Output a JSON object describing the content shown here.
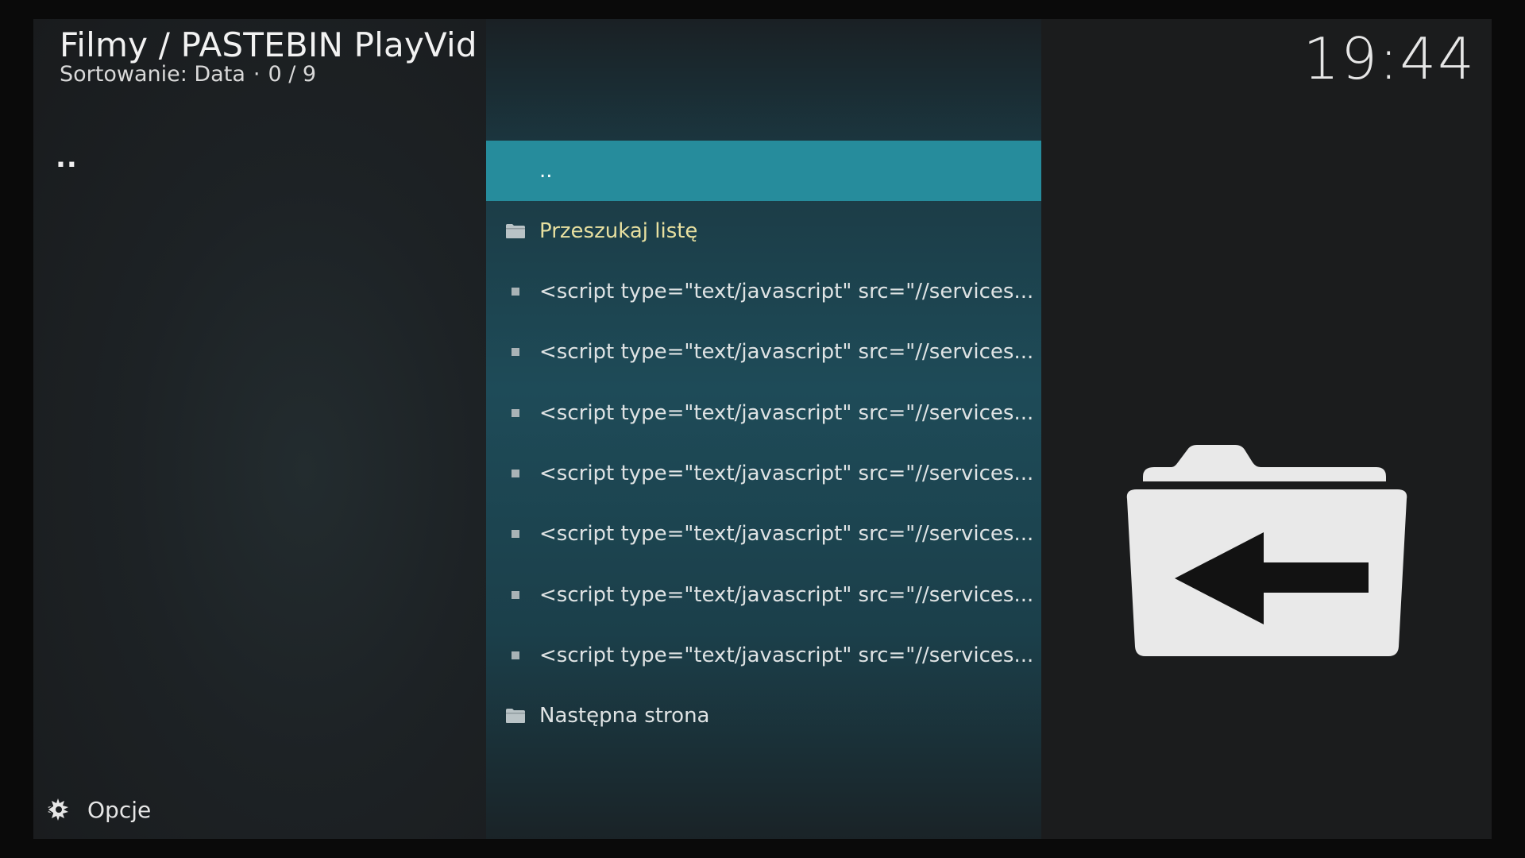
{
  "header": {
    "path": "Filmy / PASTEBIN PlayVid",
    "sort_label": "Sortowanie: Data",
    "separator": "·",
    "position": "0 / 9"
  },
  "clock": "19:44",
  "left": {
    "parent_marker": ".."
  },
  "list": {
    "items": [
      {
        "label": "..",
        "kind": "parent",
        "selected": true
      },
      {
        "label": "Przeszukaj listę",
        "kind": "folder"
      },
      {
        "label": "<script type=\"text/javascript\" src=\"//services...",
        "kind": "file"
      },
      {
        "label": "<script type=\"text/javascript\" src=\"//services...",
        "kind": "file"
      },
      {
        "label": "<script type=\"text/javascript\" src=\"//services...",
        "kind": "file"
      },
      {
        "label": "<script type=\"text/javascript\" src=\"//services...",
        "kind": "file"
      },
      {
        "label": "<script type=\"text/javascript\" src=\"//services...",
        "kind": "file"
      },
      {
        "label": "<script type=\"text/javascript\" src=\"//services...",
        "kind": "file"
      },
      {
        "label": "<script type=\"text/javascript\" src=\"//services...",
        "kind": "file"
      },
      {
        "label": "Następna strona",
        "kind": "folder"
      }
    ]
  },
  "footer": {
    "options_label": "Opcje"
  },
  "preview": {
    "icon": "folder-back-icon"
  },
  "colors": {
    "selection": "#268c9c",
    "folder_highlight": "#e8e0a0"
  }
}
